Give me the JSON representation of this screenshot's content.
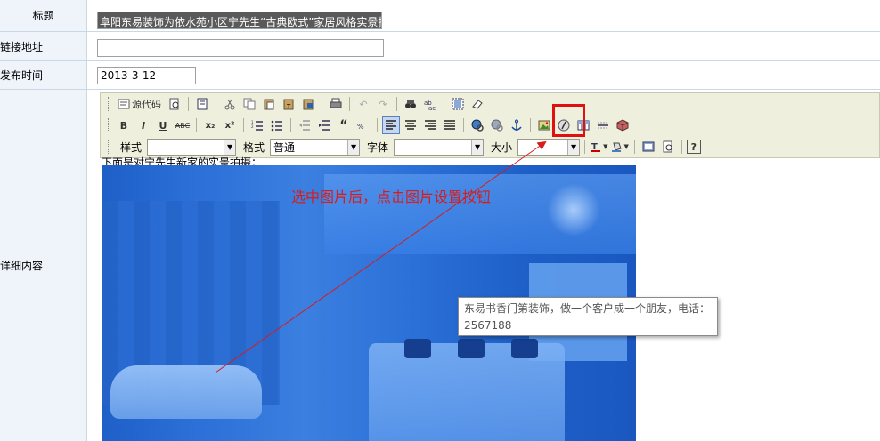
{
  "form": {
    "title_label": "标题",
    "title_value": "阜阳东易装饰为依水苑小区宁先生“古典欧式”家居风格实景拍",
    "link_label": "链接地址",
    "link_value": "",
    "date_label": "发布时间",
    "date_value": "2013-3-12",
    "content_label": "详细内容"
  },
  "toolbar": {
    "source_label": "源代码",
    "bold": "B",
    "italic": "I",
    "underline": "U",
    "strike": "ABC",
    "subscript": "x₂",
    "superscript": "x²",
    "style_label": "样式",
    "style_value": "",
    "format_label": "格式",
    "format_value": "普通",
    "font_label": "字体",
    "font_value": "",
    "size_label": "大小",
    "size_value": ""
  },
  "editor": {
    "first_line": "下面是对宁先生新家的实景拍摄："
  },
  "annotation": {
    "text": "选中图片后，点击图片设置按钮",
    "color": "#d81c1c"
  },
  "tooltip": {
    "line1": "东易书香门第装饰，做一个客户成一个朋友，电话：",
    "line2": "2567188"
  },
  "colors": {
    "label_bg": "#eef4fa",
    "toolbar_bg": "#efefde",
    "highlight": "#e01010",
    "photo_tint": "#2c70d8"
  }
}
